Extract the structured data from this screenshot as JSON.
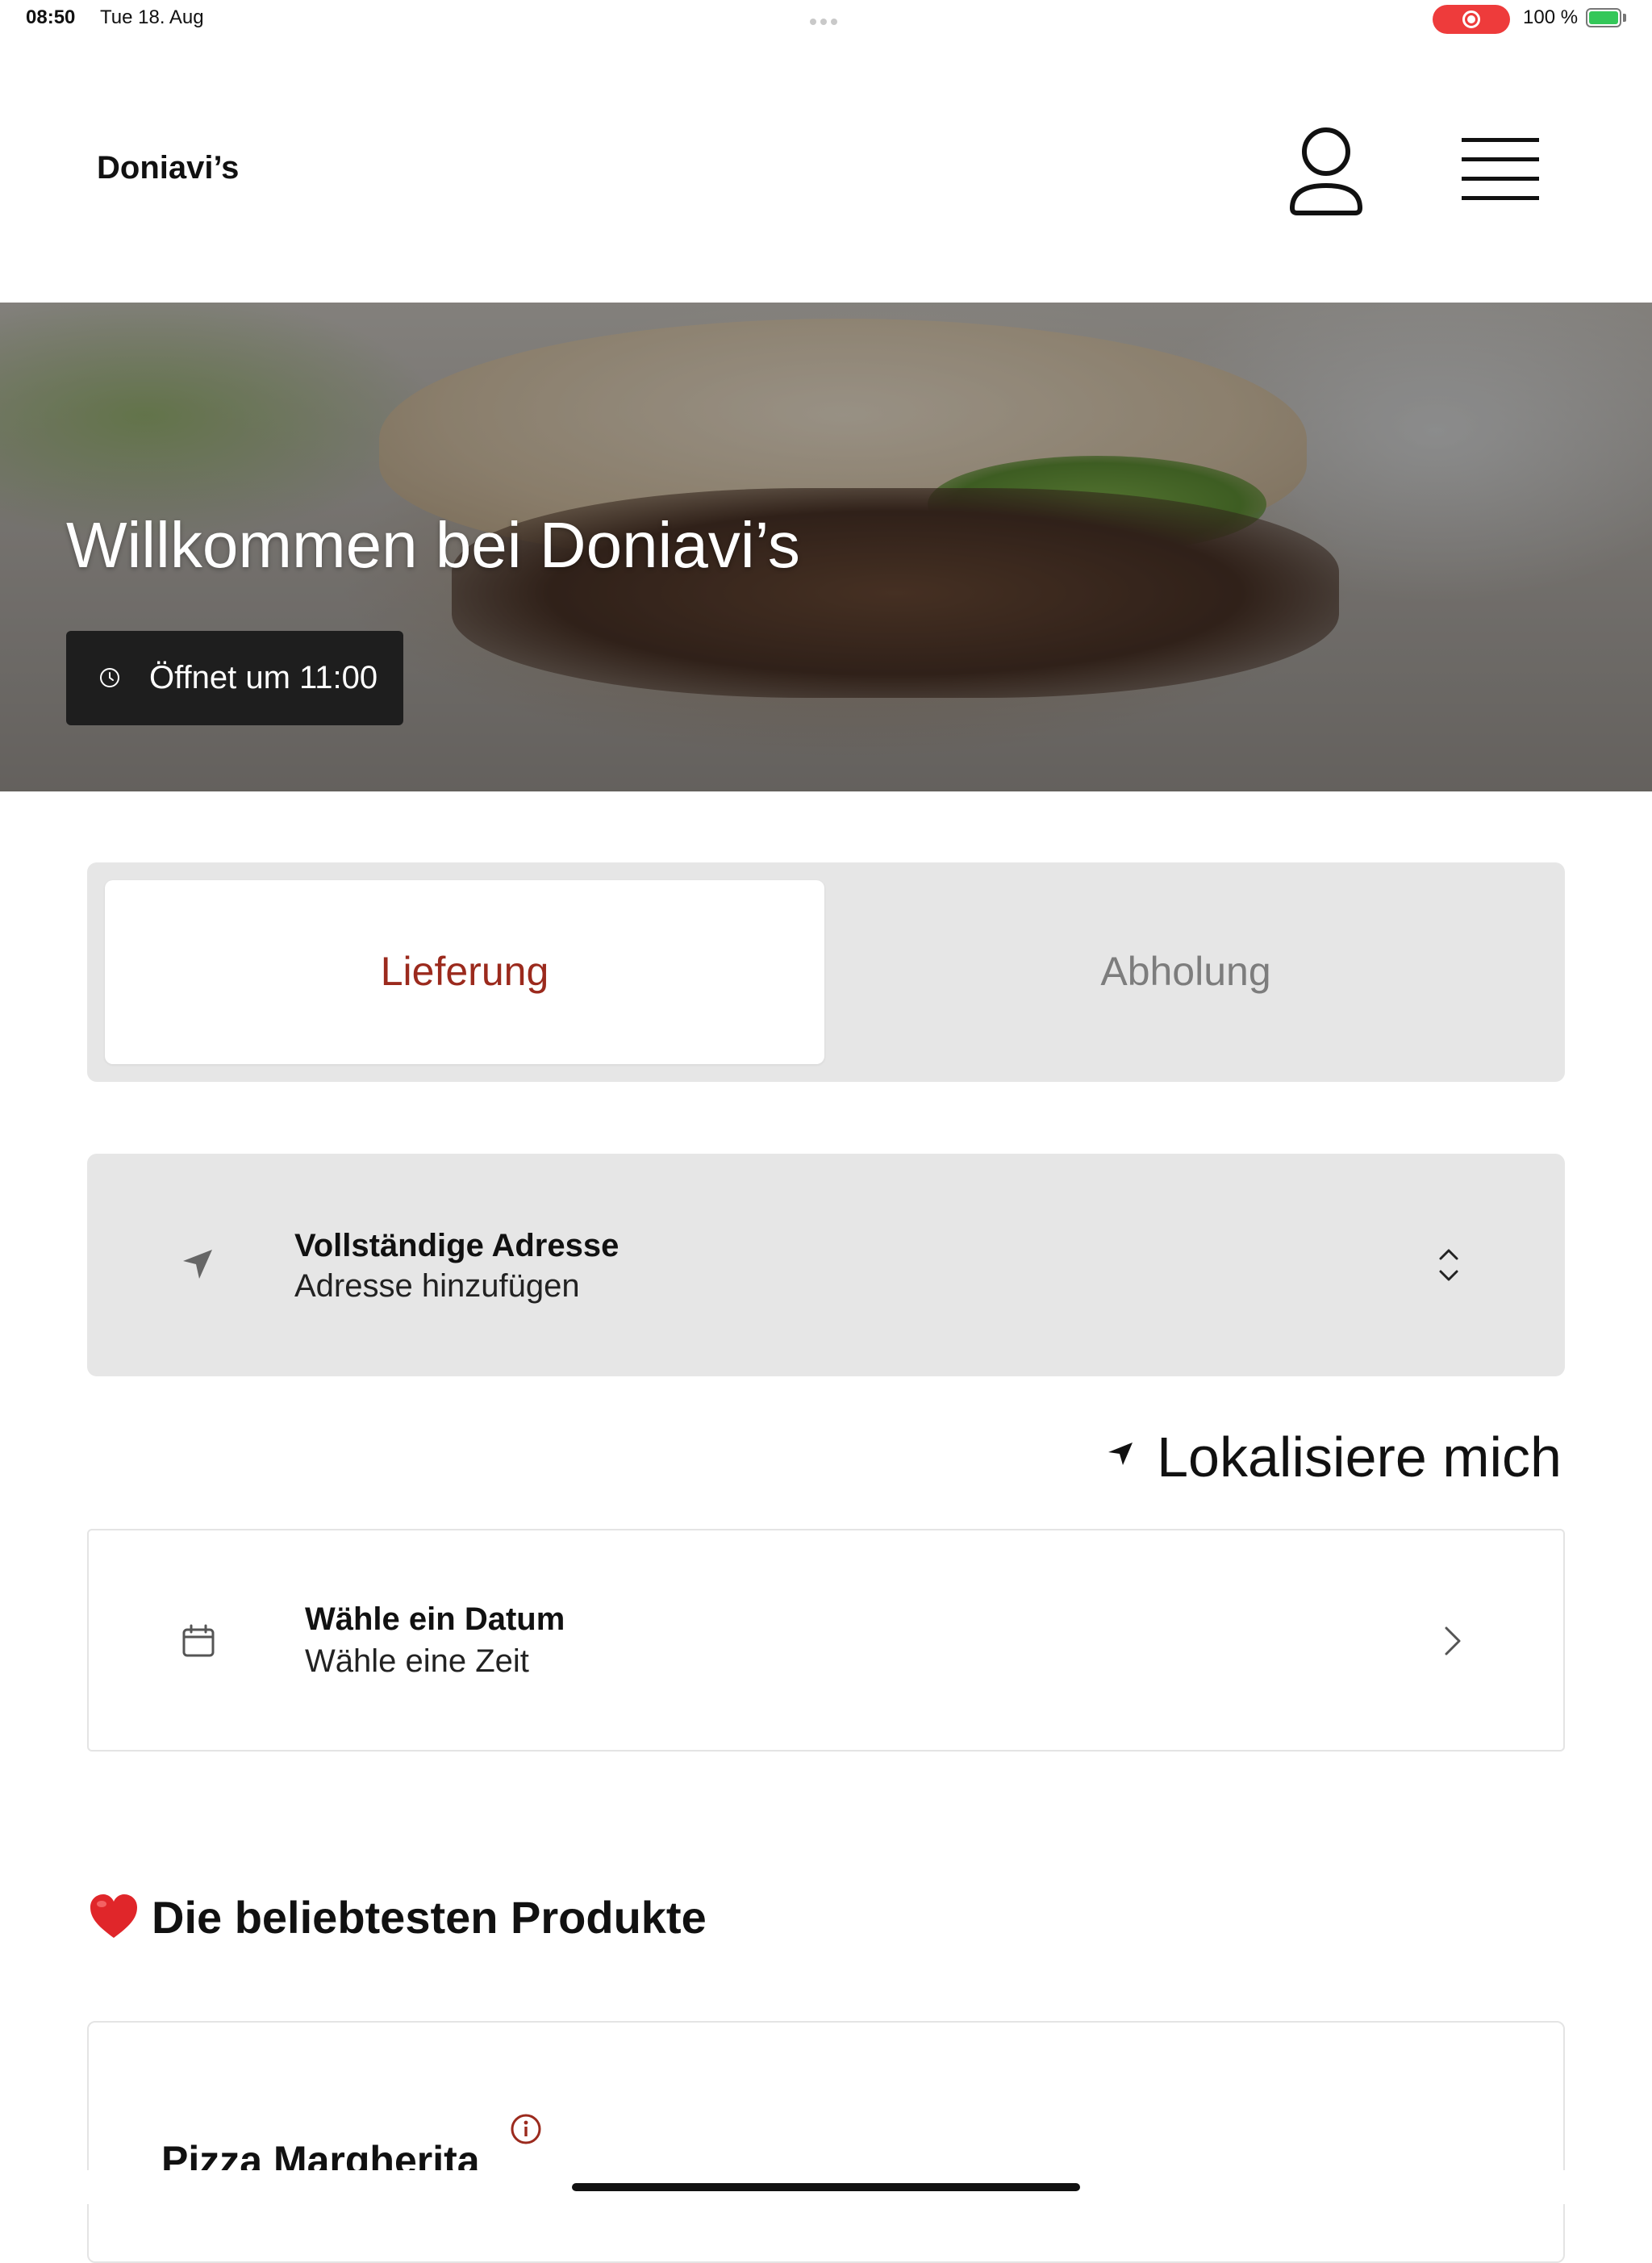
{
  "status_bar": {
    "time": "08:50",
    "date": "Tue 18. Aug",
    "battery": "100 %"
  },
  "header": {
    "brand": "Doniavi’s",
    "icons": {
      "user": "user-icon",
      "menu": "hamburger-menu-icon"
    }
  },
  "hero": {
    "title": "Willkommen bei Doniavi’s",
    "opening": "Öffnet um 11:00"
  },
  "mode_tabs": [
    {
      "label": "Lieferung",
      "selected": true
    },
    {
      "label": "Abholung",
      "selected": false
    }
  ],
  "address": {
    "title": "Vollständige Adresse",
    "value": "Adresse hinzufügen"
  },
  "locate": {
    "label": "Lokalisiere mich"
  },
  "schedule": {
    "title": "Wähle ein Datum",
    "subtitle": "Wähle eine Zeit"
  },
  "popular": {
    "title": "Die beliebtesten Produkte",
    "products": [
      {
        "name": "Pizza Margherita"
      }
    ]
  },
  "colors": {
    "accent": "#9b2a1d",
    "segment_bg": "#e6e6e6",
    "heart": "#e0262a",
    "recording": "#ee3b3b",
    "battery": "#34c759"
  }
}
